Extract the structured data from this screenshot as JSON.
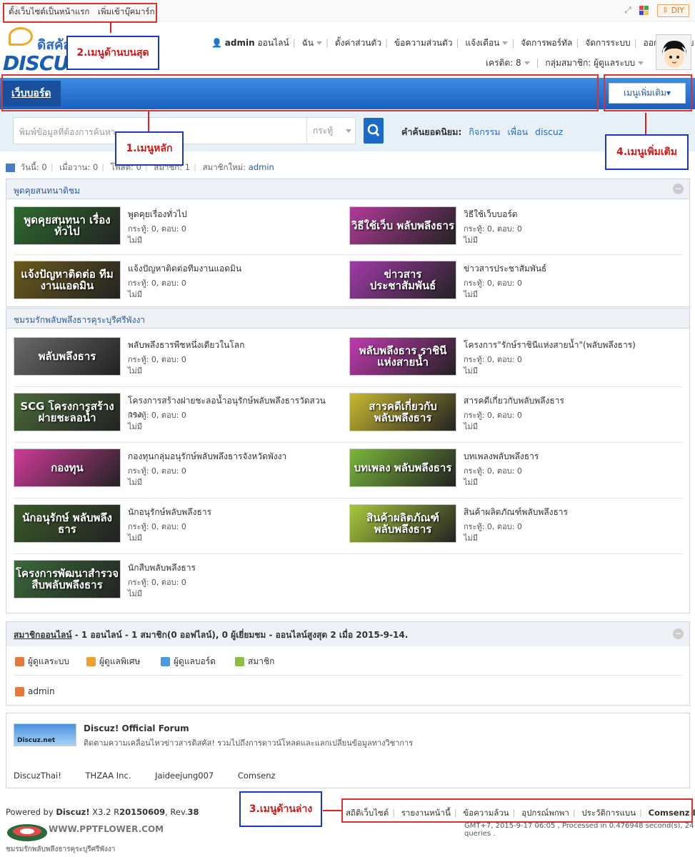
{
  "topbar": {
    "set_home": "ตั้งเว็บไซต์เป็นหน้าแรก",
    "add_bookmark": "เพิ่มเข้าบุ๊คมาร์ก",
    "diy": "DIY"
  },
  "logo": {
    "thai": "ดิสคัส",
    "en": "DISCUZ"
  },
  "usermenu": {
    "user": "admin",
    "online": "ออนไลน์",
    "me": "ฉัน",
    "settings": "ตั้งค่าส่วนตัว",
    "messages": "ข้อความส่วนตัว",
    "notify": "แจ้งเตือน",
    "portal": "จัดการพอร์ทัล",
    "system": "จัดการระบบ",
    "logout": "ออกจากระบบ",
    "credit": "เครดิต: 8",
    "group": "กลุ่มสมาชิก: ผู้ดูแลระบบ"
  },
  "nav": {
    "home": "เว็บบอร์ด",
    "more": "เมนูเพิ่มเติม"
  },
  "search": {
    "placeholder": "พิมพ์ข้อมูลที่ต้องการค้นหา",
    "type": "กระทู้",
    "hot_label": "คำค้นยอดนิยม:",
    "hot": [
      "กิจกรรม",
      "เพื่อน",
      "discuz"
    ]
  },
  "stats": {
    "today": "วันนี้: 0",
    "yesterday": "เมื่อวาน: 0",
    "posts": "โพสต์: 0",
    "members": "สมาชิก: 1",
    "newmember_label": "สมาชิกใหม่:",
    "newmember": "admin"
  },
  "cat1": {
    "title": "พูดคุยสนทนาดิชม",
    "forums": [
      {
        "img": "พูดคุยสนทนา เรื่องทั่วไป",
        "title": "พูดคุยเรื่องทั่วไป",
        "stat": "กระทู้: 0, ตอบ: 0",
        "last": "ไม่มี",
        "color": "#2e6b2e"
      },
      {
        "img": "วิธีใช้เว็บ พลับพลึงธาร",
        "title": "วิธีใช้เว็บบอร์ด",
        "stat": "กระทู้: 0, ตอบ: 0",
        "last": "ไม่มี",
        "color": "#b23a9a"
      },
      {
        "img": "แจ้งปัญหาติดต่อ ทีมงานแอดมิน",
        "title": "แจ้งปัญหาติดต่อทีมงานแอดมิน",
        "stat": "กระทู้: 0, ตอบ: 0",
        "last": "ไม่มี",
        "color": "#6b5a1a"
      },
      {
        "img": "ข่าวสาร ประชาสัมพันธ์",
        "title": "ข่าวสารประชาสัมพันธ์",
        "stat": "กระทู้: 0, ตอบ: 0",
        "last": "ไม่มี",
        "color": "#a03aa8"
      }
    ]
  },
  "cat2": {
    "title": "ชมรมรักพลับพลึงธารคุระบุรีศรีพังงา",
    "forums": [
      {
        "img": "พลับพลึงธาร",
        "title": "พลับพลึงธารพืชหนึ่งเดียวในโลก",
        "stat": "กระทู้: 0, ตอบ: 0",
        "last": "ไม่มี",
        "color": "#6a6a6a"
      },
      {
        "img": "พลับพลึงธาร ราชินีแห่งสายน้ำ",
        "title": "โครงการ\"รักษ์ราชินีแห่งสายน้ำ\"(พลับพลึงธาร)",
        "stat": "กระทู้: 0, ตอบ: 0",
        "last": "ไม่มี",
        "color": "#c03ab0"
      },
      {
        "img": "SCG โครงการสร้างฝายชะลอน้ำ",
        "title": "โครงการสร้างฝายชะลอน้ำอนุรักษ์พลับพลึงธารวัดสวนวาง",
        "stat": "กระทู้: 0, ตอบ: 0",
        "last": "ไม่มี",
        "color": "#4a6a3a"
      },
      {
        "img": "สารคดีเกี่ยวกับ พลับพลึงธาร",
        "title": "สารคดีเกี่ยวกับพลับพลึงธาร",
        "stat": "กระทู้: 0, ตอบ: 0",
        "last": "ไม่มี",
        "color": "#c8b830"
      },
      {
        "img": "กองทุน",
        "title": "กองทุนกลุ่มอนุรักษ์พลับพลึงธารจังหวัดพังงา",
        "stat": "กระทู้: 0, ตอบ: 0",
        "last": "ไม่มี",
        "color": "#d03a9a"
      },
      {
        "img": "บทเพลง พลับพลึงธาร",
        "title": "บทเพลงพลับพลึงธาร",
        "stat": "กระทู้: 0, ตอบ: 0",
        "last": "ไม่มี",
        "color": "#7ab83a"
      },
      {
        "img": "นักอนุรักษ์ พลับพลึงธาร",
        "title": "นักอนุรักษ์พลับพลึงธาร",
        "stat": "กระทู้: 0, ตอบ: 0",
        "last": "ไม่มี",
        "color": "#3a5a2a"
      },
      {
        "img": "สินค้าผลิตภัณฑ์ พลับพลึงธาร",
        "title": "สินค้าผลิตภัณฑ์พลับพลึงธาร",
        "stat": "กระทู้: 0, ตอบ: 0",
        "last": "ไม่มี",
        "color": "#a8c83a"
      },
      {
        "img": "โครงการพัฒนาสำรวจ สืบพลับพลึงธาร",
        "title": "นักสืบพลับพลึงธาร",
        "stat": "กระทู้: 0, ตอบ: 0",
        "last": "ไม่มี",
        "color": "#3a6a3a"
      }
    ]
  },
  "online": {
    "title_link": "สมาชิกออนไลน์",
    "summary": " - 1 ออนไลน์ - 1 สมาชิก(0 ออฟไลน์), 0 ผู้เยี่ยมชม - ออนไลน์สูงสุด 2 เมื่อ 2015-9-14.",
    "legend": [
      {
        "label": "ผู้ดูแลระบบ",
        "color": "#e8773a"
      },
      {
        "label": "ผู้ดูแลพิเศษ",
        "color": "#f0a030"
      },
      {
        "label": "ผู้ดูแลบอร์ด",
        "color": "#4a9ae0"
      },
      {
        "label": "สมาชิก",
        "color": "#8ac040"
      }
    ],
    "user": "admin"
  },
  "links": {
    "img_text": "Discuz.net",
    "title": "Discuz! Official Forum",
    "desc": "ติดตามความเคลื่อนไหวข่าวสารดิสคัส! รวมไปถึงการดาวน์โหลดและแลกเปลี่ยนข้อมูลทางวิชาการ",
    "partners": [
      "DiscuzThai!",
      "THZAA Inc.",
      "Jaideejung007",
      "Comsenz"
    ]
  },
  "footer": {
    "powered_prefix": "Powered by ",
    "product": "Discuz!",
    "version": " X3.2 R",
    "release": "20150609",
    "rev_label": ", Rev.",
    "rev": "38",
    "links": [
      "สถิติเว็บไซต์",
      "รายงานหน้านี้",
      "ข้อความล้วน",
      "อุปกรณ์พกพา",
      "ประวัติการแบน"
    ],
    "company": "Comsenz Inc.",
    "gmt": "GMT+7, 2015-9-17 06:05 , Processed in 0.476948 second(s), 24 queries .",
    "watermark": "WWW.PPTFLOWER.COM",
    "watermark2": "ชมรมรักพลับพลึงธารคุระบุรีศรีพังงา"
  },
  "annotations": {
    "a1": "1.เมนูหลัก",
    "a2": "2.เมนูด้านบนสุด",
    "a3": "3.เมนูด้านล่าง",
    "a4": "4.เมนูเพิ่มเติม"
  }
}
